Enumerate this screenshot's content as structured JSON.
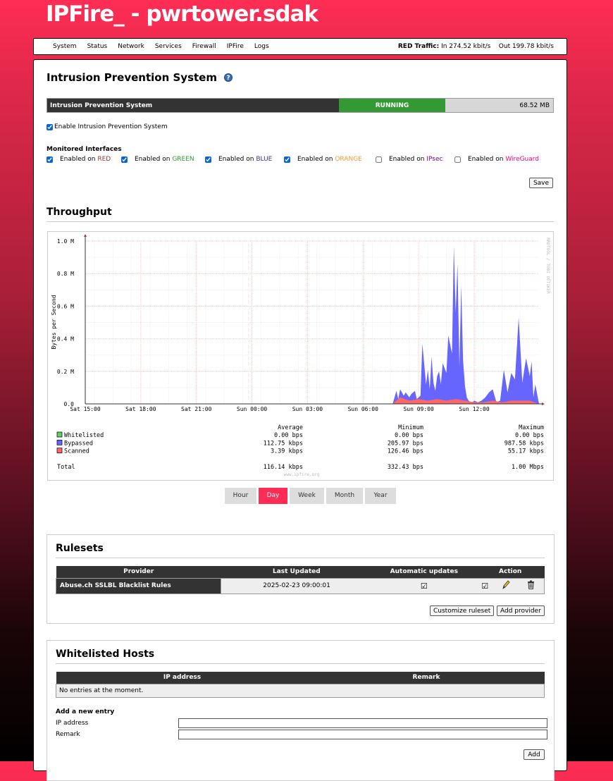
{
  "app": {
    "title": "IPFire_ - pwrtower.sdak"
  },
  "nav": {
    "items": [
      "System",
      "Status",
      "Network",
      "Services",
      "Firewall",
      "IPFire",
      "Logs"
    ],
    "traffic_label": "RED Traffic:",
    "traffic_in": "In 274.52 kbit/s",
    "traffic_out": "Out 199.78 kbit/s"
  },
  "page": {
    "title": "Intrusion Prevention System",
    "help_icon": "?"
  },
  "status": {
    "name": "Intrusion Prevention System",
    "state": "RUNNING",
    "memory": "68.52 MB",
    "state_color": "#339933"
  },
  "enable": {
    "label": "Enable Intrusion Prevention System",
    "checked": true
  },
  "monitored": {
    "title": "Monitored Interfaces",
    "items": [
      {
        "prefix": "Enabled on",
        "zone": "RED",
        "color": "#993333",
        "checked": true
      },
      {
        "prefix": "Enabled on",
        "zone": "GREEN",
        "color": "#339933",
        "checked": true
      },
      {
        "prefix": "Enabled on",
        "zone": "BLUE",
        "color": "#333399",
        "checked": true
      },
      {
        "prefix": "Enabled on",
        "zone": "ORANGE",
        "color": "#ff9933",
        "checked": true
      },
      {
        "prefix": "Enabled on",
        "zone": "IPsec",
        "color": "#800080",
        "checked": false
      },
      {
        "prefix": "Enabled on",
        "zone": "WireGuard",
        "color": "#ff007f",
        "checked": false
      }
    ],
    "save_label": "Save"
  },
  "throughput": {
    "title": "Throughput",
    "periods": [
      "Hour",
      "Day",
      "Week",
      "Month",
      "Year"
    ],
    "active_period": "Day",
    "footer": "www.ipfire.org",
    "side_label": "RRDTOOL / TOBI OETIKER",
    "legend_headers": [
      "Average",
      "Minimum",
      "Maximum"
    ],
    "legend_rows": [
      {
        "name": "Whitelisted",
        "color": "#66cc66",
        "avg": "0.00  bps",
        "min": "0.00  bps",
        "max": "0.00  bps"
      },
      {
        "name": "Bypassed",
        "color": "#6666ff",
        "avg": "112.75 kbps",
        "min": "205.97  bps",
        "max": "987.58 kbps"
      },
      {
        "name": "Scanned",
        "color": "#ff6666",
        "avg": "3.39 kbps",
        "min": "126.46  bps",
        "max": "55.17 kbps"
      }
    ],
    "total": {
      "name": "Total",
      "avg": "116.14 kbps",
      "min": "332.43  bps",
      "max": "1.00 Mbps"
    }
  },
  "chart_data": {
    "type": "area",
    "ylabel": "Bytes per Second",
    "ylim": [
      0,
      1.0
    ],
    "yticks": [
      0.0,
      0.2,
      0.4,
      0.6,
      0.8,
      1.0
    ],
    "ytick_labels": [
      "0.0",
      "0.2 M",
      "0.4 M",
      "0.6 M",
      "0.8 M",
      "1.0 M"
    ],
    "xlim_hours": [
      0,
      24.5
    ],
    "xticks_hours": [
      0,
      3,
      6,
      9,
      12,
      15,
      18,
      21
    ],
    "xtick_labels": [
      "Sat 15:00",
      "Sat 18:00",
      "Sat 21:00",
      "Sun 00:00",
      "Sun 03:00",
      "Sun 06:00",
      "Sun 09:00",
      "Sun 12:00"
    ],
    "grid": true,
    "series": [
      {
        "name": "Bypassed",
        "color": "#6666ff",
        "x": [
          16.6,
          16.8,
          16.9,
          17.0,
          17.2,
          17.3,
          17.5,
          17.6,
          17.8,
          17.9,
          18.1,
          18.2,
          18.4,
          18.5,
          18.6,
          18.7,
          18.8,
          18.9,
          19.0,
          19.1,
          19.2,
          19.3,
          19.5,
          19.6,
          19.8,
          19.9,
          20.0,
          20.1,
          20.2,
          20.3,
          20.4,
          20.5,
          20.6,
          20.7,
          20.8,
          20.9,
          21.0,
          21.2,
          21.4,
          21.6,
          21.8,
          22.0,
          22.2,
          22.4,
          22.6,
          22.8,
          23.0,
          23.2,
          23.4,
          23.6,
          23.8,
          24.0,
          24.1,
          24.2,
          24.3,
          24.5
        ],
        "y": [
          0.0,
          0.08,
          0.03,
          0.09,
          0.05,
          0.07,
          0.04,
          0.06,
          0.08,
          0.03,
          0.05,
          0.37,
          0.12,
          0.21,
          0.09,
          0.29,
          0.13,
          0.08,
          0.17,
          0.2,
          0.12,
          0.25,
          0.19,
          0.42,
          0.31,
          0.97,
          0.56,
          0.86,
          0.23,
          0.73,
          0.27,
          0.11,
          0.04,
          0.02,
          0.01,
          0.01,
          0.02,
          0.01,
          0.02,
          0.04,
          0.07,
          0.09,
          0.01,
          0.02,
          0.21,
          0.07,
          0.19,
          0.15,
          0.53,
          0.13,
          0.28,
          0.17,
          0.26,
          0.04,
          0.12,
          0.0
        ]
      },
      {
        "name": "Scanned",
        "color": "#ff6666",
        "x": [
          16.6,
          17.0,
          17.5,
          18.0,
          18.5,
          19.0,
          19.5,
          20.0,
          20.5,
          21.0,
          21.5,
          22.0,
          22.5,
          23.0,
          23.5,
          24.0,
          24.5
        ],
        "y": [
          0.0,
          0.04,
          0.02,
          0.03,
          0.02,
          0.03,
          0.02,
          0.03,
          0.02,
          0.01,
          0.01,
          0.02,
          0.01,
          0.02,
          0.02,
          0.02,
          0.0
        ]
      }
    ]
  },
  "rulesets": {
    "title": "Rulesets",
    "headers": [
      "Provider",
      "Last Updated",
      "Automatic updates",
      "Action"
    ],
    "rows": [
      {
        "provider": "Abuse.ch SSLBL Blacklist Rules",
        "updated": "2025-02-23 09:00:01"
      }
    ],
    "customize_label": "Customize ruleset",
    "add_provider_label": "Add provider"
  },
  "whitelist": {
    "title": "Whitelisted Hosts",
    "headers": [
      "IP address",
      "Remark"
    ],
    "empty_text": "No entries at the moment.",
    "add_title": "Add a new entry",
    "ip_label": "IP address",
    "remark_label": "Remark",
    "ip_value": "",
    "remark_value": "",
    "add_label": "Add"
  }
}
